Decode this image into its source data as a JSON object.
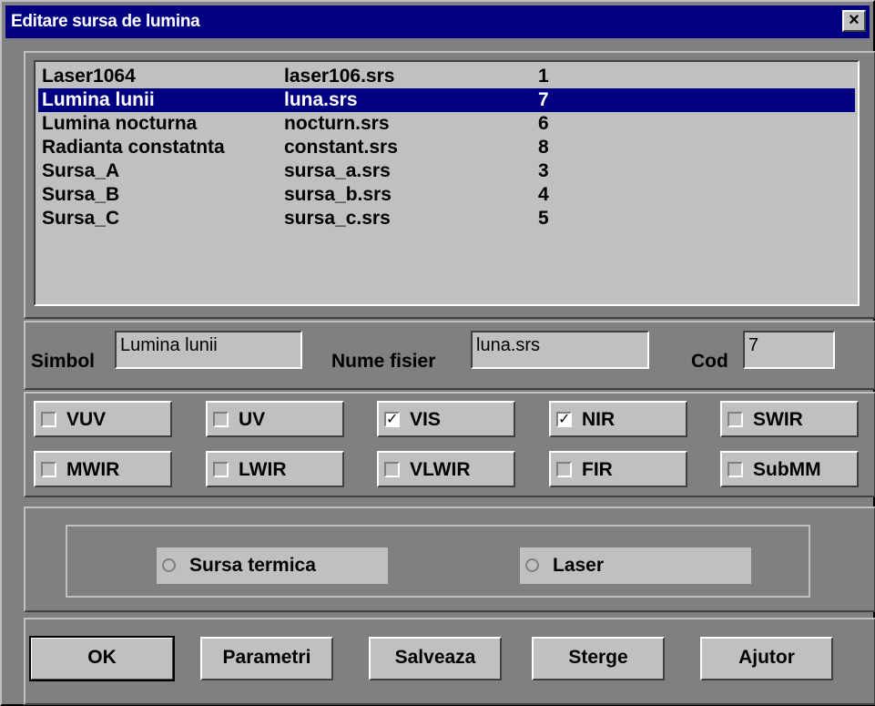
{
  "window": {
    "title": "Editare sursa de lumina",
    "close_label": "×"
  },
  "list": {
    "rows": [
      {
        "symbol": "Laser1064",
        "file": "laser106.srs",
        "code": "1",
        "selected": false
      },
      {
        "symbol": "Lumina lunii",
        "file": "luna.srs",
        "code": "7",
        "selected": true
      },
      {
        "symbol": "Lumina nocturna",
        "file": "nocturn.srs",
        "code": "6",
        "selected": false
      },
      {
        "symbol": "Radianta constatnta",
        "file": "constant.srs",
        "code": "8",
        "selected": false
      },
      {
        "symbol": "Sursa_A",
        "file": "sursa_a.srs",
        "code": "3",
        "selected": false
      },
      {
        "symbol": "Sursa_B",
        "file": "sursa_b.srs",
        "code": "4",
        "selected": false
      },
      {
        "symbol": "Sursa_C",
        "file": "sursa_c.srs",
        "code": "5",
        "selected": false
      }
    ]
  },
  "fields": {
    "symbol_label": "Simbol",
    "symbol_value": "Lumina lunii",
    "filename_label": "Nume fisier",
    "filename_value": "luna.srs",
    "code_label": "Cod",
    "code_value": "7"
  },
  "bands": [
    {
      "label": "VUV",
      "checked": false
    },
    {
      "label": "UV",
      "checked": false
    },
    {
      "label": "VIS",
      "checked": true
    },
    {
      "label": "NIR",
      "checked": true
    },
    {
      "label": "SWIR",
      "checked": false
    },
    {
      "label": "MWIR",
      "checked": false
    },
    {
      "label": "LWIR",
      "checked": false
    },
    {
      "label": "VLWIR",
      "checked": false
    },
    {
      "label": "FIR",
      "checked": false
    },
    {
      "label": "SubMM",
      "checked": false
    }
  ],
  "source_type": {
    "thermal_label": "Sursa termica",
    "laser_label": "Laser",
    "thermal_selected": false,
    "laser_selected": false
  },
  "buttons": {
    "ok": "OK",
    "params": "Parametri",
    "save": "Salveaza",
    "delete": "Sterge",
    "help": "Ajutor"
  },
  "colors": {
    "titlebar": "#000080",
    "dialog_bg": "#808080",
    "control_bg": "#c0c0c0",
    "selection": "#000080"
  }
}
